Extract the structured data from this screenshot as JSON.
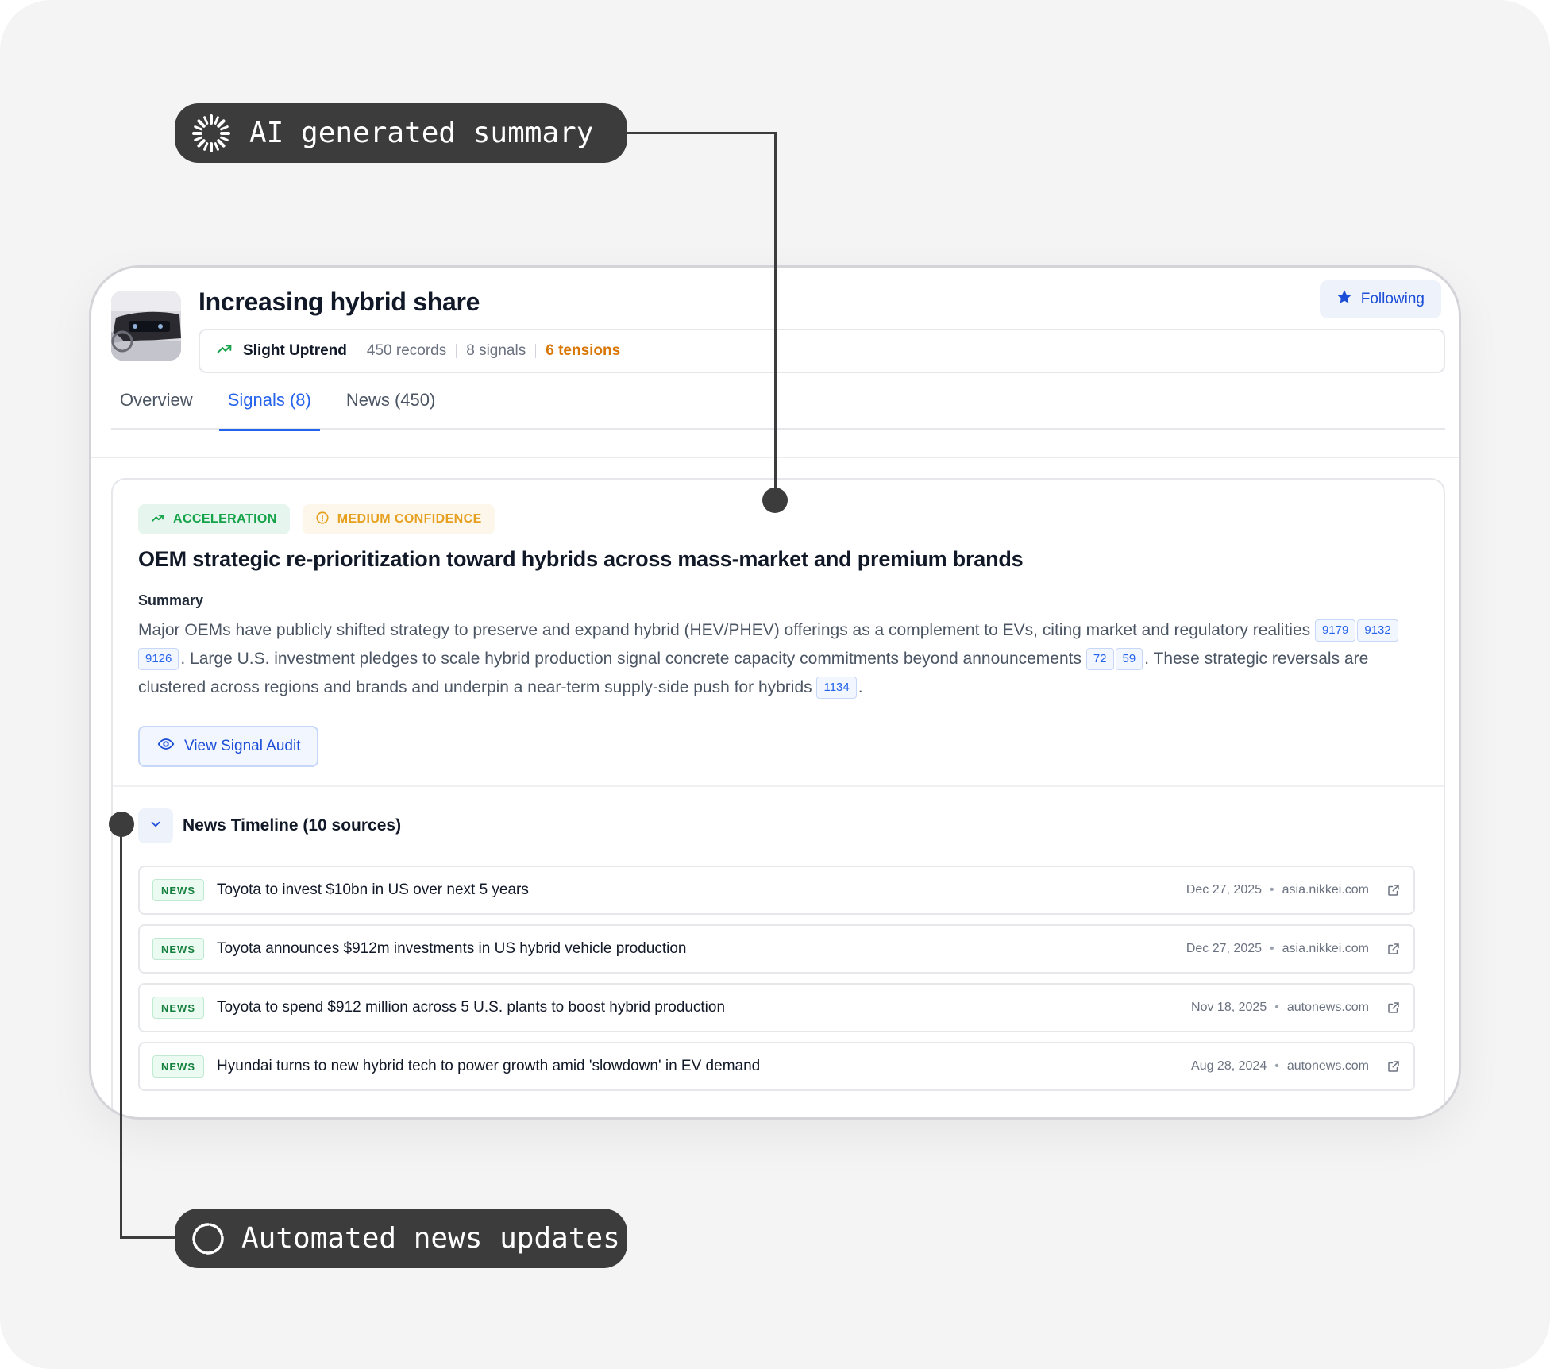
{
  "callouts": {
    "top": "AI generated summary",
    "bottom": "Automated news updates"
  },
  "topic": {
    "title": "Increasing hybrid share",
    "follow_label": "Following",
    "trend_label": "Slight Uptrend",
    "records": "450 records",
    "signals": "8 signals",
    "tensions": "6 tensions"
  },
  "tabs": [
    {
      "label": "Overview",
      "active": false
    },
    {
      "label": "Signals (8)",
      "active": true
    },
    {
      "label": "News (450)",
      "active": false
    }
  ],
  "signal": {
    "badge_type": "ACCELERATION",
    "badge_confidence": "MEDIUM CONFIDENCE",
    "title": "OEM strategic re-prioritization toward hybrids across mass-market and premium brands",
    "summary_label": "Summary",
    "summary_parts": {
      "p1": "Major OEMs have publicly shifted strategy to preserve and expand hybrid (HEV/PHEV) offerings as a complement to EVs, citing market and regulatory realities ",
      "refs1": [
        "9179",
        "9132",
        "9126"
      ],
      "p2": ". Large U.S. investment pledges to scale hybrid production signal concrete capacity commitments beyond announcements ",
      "refs2": [
        "72",
        "59"
      ],
      "p3": ". These strategic reversals are clustered across regions and brands and underpin a near-term supply-side push for hybrids ",
      "refs3": [
        "1134"
      ],
      "p4": "."
    },
    "audit_label": "View Signal Audit"
  },
  "timeline": {
    "title": "News Timeline (10 sources)",
    "items": [
      {
        "tag": "NEWS",
        "title": "Toyota to invest $10bn in US over next 5 years",
        "date": "Dec 27, 2025",
        "source": "asia.nikkei.com"
      },
      {
        "tag": "NEWS",
        "title": "Toyota announces $912m investments in US hybrid vehicle production",
        "date": "Dec 27, 2025",
        "source": "asia.nikkei.com"
      },
      {
        "tag": "NEWS",
        "title": "Toyota to spend $912 million across 5 U.S. plants to boost hybrid production",
        "date": "Nov 18, 2025",
        "source": "autonews.com"
      },
      {
        "tag": "NEWS",
        "title": "Hyundai turns to new hybrid tech to power growth amid 'slowdown' in EV demand",
        "date": "Aug 28, 2024",
        "source": "autonews.com"
      }
    ]
  },
  "colors": {
    "accent_blue": "#2563eb",
    "acceleration_green": "#16a34a",
    "confidence_amber": "#e6a020",
    "tensions_orange": "#d97706",
    "callout_dark": "#3c3c3c"
  },
  "icons": {
    "top_callout": "sparkle-loader-icon",
    "bottom_callout": "dashed-circle-icon",
    "follow": "star-icon",
    "trend": "trending-up-icon",
    "confidence": "alert-circle-icon",
    "audit": "eye-icon",
    "timeline_toggle": "chevron-down-icon",
    "news_link": "external-link-icon"
  }
}
